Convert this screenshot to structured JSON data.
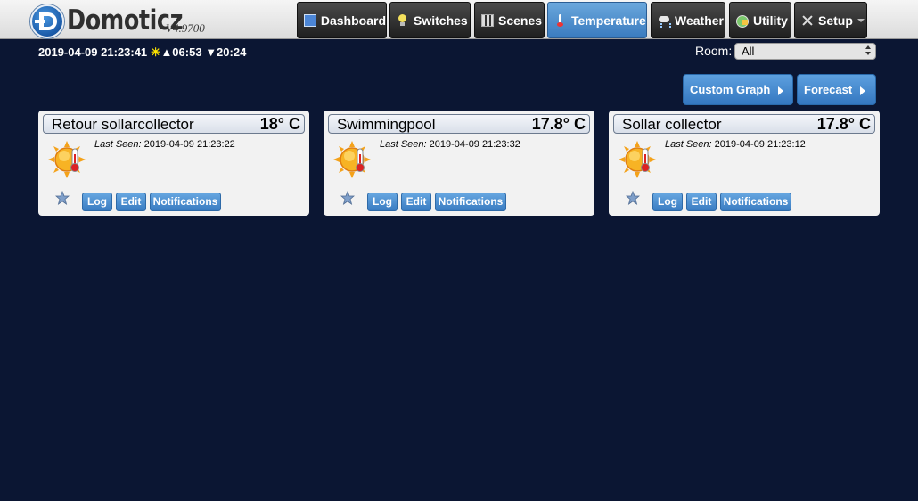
{
  "app": {
    "name": "Domoticz",
    "version": "V4.9700"
  },
  "nav": [
    {
      "label": "Dashboard",
      "icon": "dashboard-icon"
    },
    {
      "label": "Switches",
      "icon": "lightbulb-icon"
    },
    {
      "label": "Scenes",
      "icon": "clapperboard-icon"
    },
    {
      "label": "Temperature",
      "icon": "thermometer-icon",
      "active": true
    },
    {
      "label": "Weather",
      "icon": "rain-cloud-icon"
    },
    {
      "label": "Utility",
      "icon": "utility-icon"
    },
    {
      "label": "Setup",
      "icon": "tools-icon",
      "dropdown": true
    }
  ],
  "status": {
    "datetime": "2019-04-09 21:23:41",
    "sunrise": "▲06:53",
    "sunset": "▼20:24"
  },
  "room": {
    "label": "Room:",
    "selected": "All"
  },
  "actions": {
    "custom_graph": "Custom Graph",
    "forecast": "Forecast"
  },
  "card_buttons": {
    "log": "Log",
    "edit": "Edit",
    "notifications": "Notifications"
  },
  "last_seen_label": "Last Seen:",
  "devices": [
    {
      "name": "Retour sollarcollector",
      "temperature": "18° C",
      "last_seen": "2019-04-09 21:23:22"
    },
    {
      "name": "Swimmingpool",
      "temperature": "17.8° C",
      "last_seen": "2019-04-09 21:23:32"
    },
    {
      "name": "Sollar collector",
      "temperature": "17.8° C",
      "last_seen": "2019-04-09 21:23:12"
    }
  ],
  "colors": {
    "background": "#0b1633",
    "accent": "#3a7cc2",
    "card": "#f2f2f2"
  }
}
